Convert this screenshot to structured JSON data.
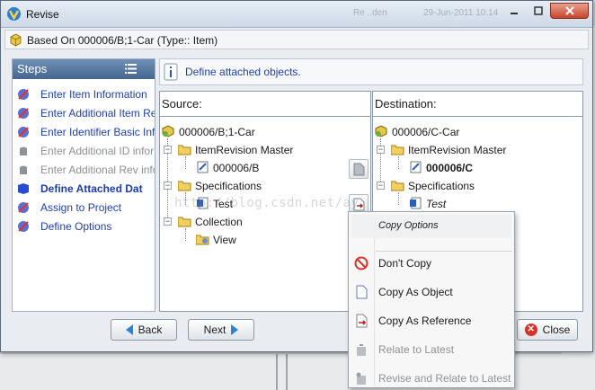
{
  "window": {
    "title": "Revise",
    "background_ghost_left": "Re ..den",
    "background_ghost_right": "29-Jun-2011 10:14"
  },
  "based_on": "Based On 000006/B;1-Car (Type:: Item)",
  "steps": {
    "header": "Steps",
    "items": [
      {
        "label": "Enter Item Information",
        "state": "enabled"
      },
      {
        "label": "Enter Additional Item Re",
        "state": "enabled"
      },
      {
        "label": "Enter Identifier Basic Info",
        "state": "enabled"
      },
      {
        "label": "Enter Additional ID infor",
        "state": "disabled"
      },
      {
        "label": "Enter Additional Rev info",
        "state": "disabled"
      },
      {
        "label": "Define Attached Dat",
        "state": "current"
      },
      {
        "label": "Assign to Project",
        "state": "enabled"
      },
      {
        "label": "Define Options",
        "state": "enabled"
      }
    ]
  },
  "info": {
    "message": "Define attached objects."
  },
  "source": {
    "header": "Source:",
    "root": "000006/B;1-Car",
    "item_revision_master": "ItemRevision Master",
    "irm_child": "000006/B",
    "specifications": "Specifications",
    "spec_child": "Test",
    "collection": "Collection",
    "collection_child": "View"
  },
  "destination": {
    "header": "Destination:",
    "root": "000006/C-Car",
    "item_revision_master": "ItemRevision Master",
    "irm_child": "000006/C",
    "specifications": "Specifications",
    "spec_child": "Test"
  },
  "watermark": "http://blog.csdn.net/ay",
  "buttons": {
    "back": "Back",
    "next": "Next",
    "close": "Close"
  },
  "context_menu": {
    "header": "Copy Options",
    "items": [
      {
        "label": "Don't Copy",
        "icon": "no-entry-icon",
        "enabled": true
      },
      {
        "label": "Copy As Object",
        "icon": "document-icon",
        "enabled": true
      },
      {
        "label": "Copy As Reference",
        "icon": "reference-arrow-icon",
        "enabled": true
      },
      {
        "label": "Relate to Latest",
        "icon": "relate-icon",
        "enabled": false
      },
      {
        "label": "Revise and Relate to Latest",
        "icon": "revise-relate-icon",
        "enabled": false
      }
    ]
  },
  "colors": {
    "link_blue": "#1e3fb0",
    "steps_header": "#45678f",
    "close_red": "#d8332a"
  }
}
